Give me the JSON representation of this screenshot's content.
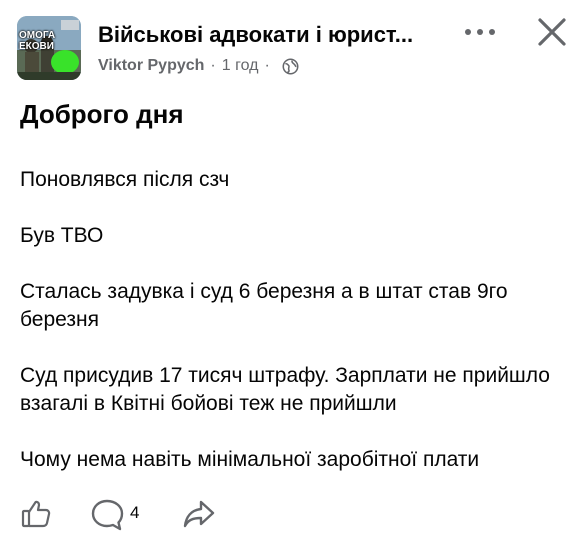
{
  "header": {
    "group_name": "Військові адвокати і юрист...",
    "author": "Viktor Pypych",
    "separator": "·",
    "time": "1 год",
    "avatar_text": "ОМОГА\nЕКОВИ",
    "icons": {
      "privacy": "globe-icon",
      "more": "more-horizontal-icon",
      "close": "close-icon"
    }
  },
  "post": {
    "title": "Доброго дня",
    "paragraphs": [
      "Поновлявся після сзч",
      "Був ТВО",
      "Сталась задувка і суд 6 березня а в штат став 9го березня",
      "Суд присудив 17 тисяч штрафу. Зарплати не прийшло взагалі в Квітні бойові теж не прийшли",
      "Чому нема навіть мінімальної заробітної плати"
    ]
  },
  "actions": {
    "like_icon": "thumbs-up-icon",
    "comment_icon": "comment-icon",
    "comment_count": "4",
    "share_icon": "share-icon"
  },
  "colors": {
    "text": "#050505",
    "secondary": "#65676b",
    "background": "#ffffff",
    "avatar_accent": "#39e22a"
  }
}
